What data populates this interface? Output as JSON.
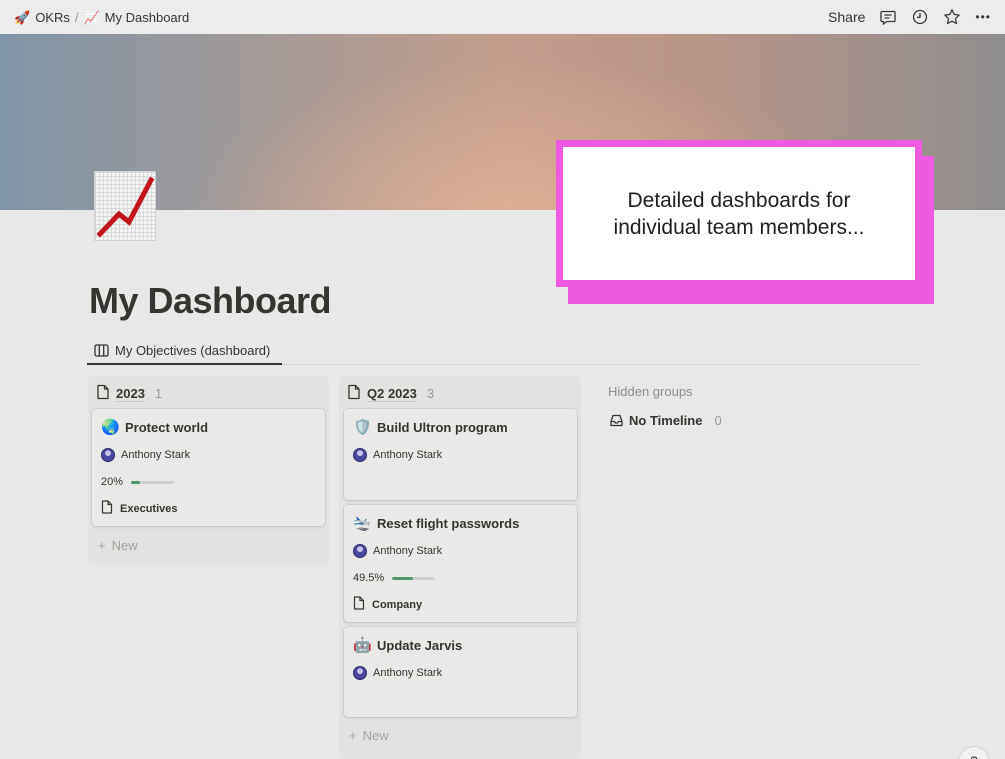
{
  "breadcrumb": {
    "items": [
      {
        "icon": "rocket-icon",
        "glyph": "🚀",
        "label": "OKRs"
      },
      {
        "icon": "chart-increasing-icon",
        "glyph": "📈",
        "label": "My Dashboard"
      }
    ],
    "separator": "/"
  },
  "topbar": {
    "share_label": "Share",
    "icons": [
      "comment-icon",
      "clock-icon",
      "star-icon",
      "more-icon"
    ],
    "more_glyph": "•••"
  },
  "page": {
    "icon": "chart-increasing-icon",
    "title": "My Dashboard"
  },
  "callout": {
    "text": "Detailed dashboards for individual team members...",
    "color": "#ee5be1"
  },
  "view_tab": {
    "icon": "board-icon",
    "label": "My Objectives (dashboard)"
  },
  "columns": [
    {
      "title": "2023",
      "count": "1",
      "cards": [
        {
          "emoji": "🌏",
          "title": "Protect world",
          "owner": "Anthony Stark",
          "progress_label": "20%",
          "progress": 0.2,
          "relation": "Executives"
        }
      ],
      "new_label": "New"
    },
    {
      "title": "Q2 2023",
      "count": "3",
      "cards": [
        {
          "emoji": "🛡️",
          "title": "Build Ultron program",
          "owner": "Anthony Stark"
        },
        {
          "emoji": "🛬",
          "title": "Reset flight passwords",
          "owner": "Anthony Stark",
          "progress_label": "49.5%",
          "progress": 0.495,
          "relation": "Company"
        },
        {
          "emoji": "🤖",
          "title": "Update Jarvis",
          "owner": "Anthony Stark"
        }
      ],
      "new_label": "New"
    }
  ],
  "hidden_groups": {
    "label": "Hidden groups",
    "items": [
      {
        "icon": "inbox-icon",
        "label": "No Timeline",
        "count": "0"
      }
    ]
  },
  "help": {
    "glyph": "?"
  },
  "colors": {
    "progress_fill": "#4f9768",
    "accent_text": "#37352f"
  }
}
